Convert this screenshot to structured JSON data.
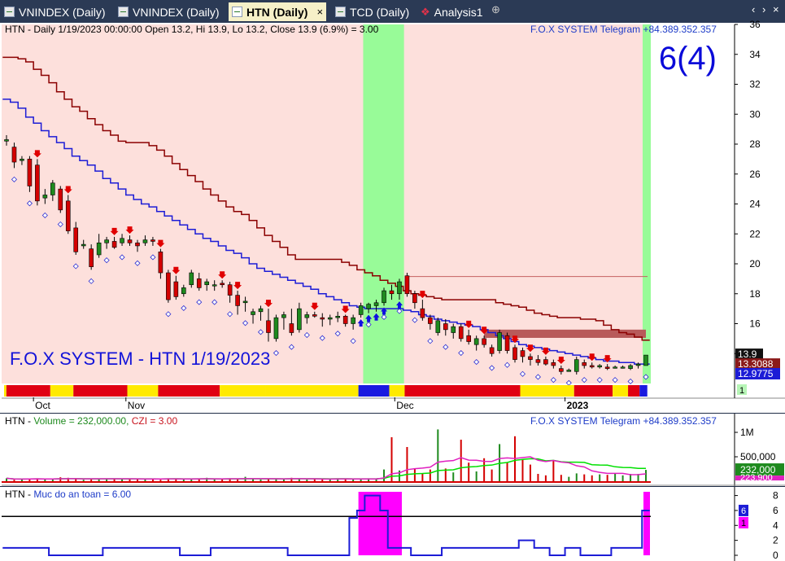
{
  "tabs": [
    {
      "label": "VNINDEX (Daily)",
      "icon": "chart-icon",
      "active": false
    },
    {
      "label": "VNINDEX (Daily)",
      "icon": "chart-icon",
      "active": false
    },
    {
      "label": "HTN (Daily)",
      "icon": "chart-icon",
      "active": true
    },
    {
      "label": "TCD (Daily)",
      "icon": "chart-icon",
      "active": false
    },
    {
      "label": "Analysis1",
      "icon": "analysis-icon",
      "active": false
    }
  ],
  "nav": {
    "add": "⊕",
    "prev": "‹",
    "next": "›",
    "close": "×"
  },
  "price_pane": {
    "header": "HTN - Daily 1/19/2023 00:00:00 Open 13.2, Hi 13.9, Lo 13.2, Close 13.9 (6.9%)  = 3.00",
    "watermark": "F.O.X SYSTEM Telegram +84.389.352.357",
    "count_label": "6(4)",
    "brand_label": "F.O.X SYSTEM - HTN 1/19/2023",
    "y_ticks": [
      "36",
      "34",
      "32",
      "30",
      "28",
      "26",
      "24",
      "22",
      "20",
      "18",
      "16",
      "14"
    ],
    "x_ticks": [
      "Oct",
      "Nov",
      "Dec",
      "2023"
    ],
    "price_close_tag": "13.9",
    "upper_line_tag": "13.3088",
    "lower_line_tag": "12.9775",
    "small_tag": "1",
    "colors": {
      "bg_pink": "#fde0dc",
      "bg_green": "#98fb98",
      "upper": "#8b0000",
      "lower": "#1c1cd6",
      "up": "#1e8a1e",
      "down": "#d40000"
    }
  },
  "volume_pane": {
    "header_sym": "HTN - ",
    "header_vol": "Volume = 232,000.00, ",
    "header_czi": "CZI = 3.00",
    "watermark": "F.O.X SYSTEM Telegram +84.389.352.357",
    "y_ticks": [
      "1M",
      "500,000"
    ],
    "vol_tag": "232,000",
    "vol_tag2": "223,900"
  },
  "safety_pane": {
    "header_sym": "HTN - ",
    "header_ind": "Muc do an toan = 6.00",
    "y_ticks": [
      "8",
      "6",
      "4",
      "2",
      "0"
    ],
    "value_tag": "6",
    "value_tag2": "1"
  },
  "chart_data": {
    "type": "candlestick",
    "symbol": "HTN",
    "ylim": [
      12,
      36
    ],
    "candles": [
      [
        28.2,
        28.6,
        27.9,
        28.3
      ],
      [
        27.8,
        28.1,
        26.4,
        26.8
      ],
      [
        26.9,
        27.2,
        26.6,
        27.0
      ],
      [
        27.0,
        27.2,
        24.8,
        25.2
      ],
      [
        26.6,
        27.0,
        23.9,
        24.2
      ],
      [
        24.4,
        25.0,
        24.0,
        24.6
      ],
      [
        24.6,
        25.6,
        24.2,
        25.4
      ],
      [
        25.0,
        25.2,
        23.4,
        23.6
      ],
      [
        24.2,
        24.6,
        22.0,
        22.2
      ],
      [
        22.4,
        22.8,
        20.6,
        20.8
      ],
      [
        21.2,
        21.6,
        21.0,
        21.3
      ],
      [
        21.0,
        21.3,
        19.6,
        19.8
      ],
      [
        20.6,
        22.0,
        20.4,
        21.4
      ],
      [
        21.4,
        21.8,
        21.0,
        21.6
      ],
      [
        21.5,
        21.8,
        21.0,
        21.1
      ],
      [
        21.4,
        22.0,
        21.2,
        21.7
      ],
      [
        21.6,
        21.9,
        21.2,
        21.4
      ],
      [
        21.4,
        21.6,
        20.8,
        21.2
      ],
      [
        21.4,
        21.9,
        21.2,
        21.6
      ],
      [
        21.6,
        21.8,
        21.2,
        21.5
      ],
      [
        20.8,
        21.0,
        19.0,
        19.4
      ],
      [
        19.4,
        19.6,
        17.4,
        17.6
      ],
      [
        18.8,
        19.2,
        17.6,
        17.8
      ],
      [
        18.0,
        18.6,
        17.8,
        18.4
      ],
      [
        18.6,
        19.6,
        18.4,
        19.4
      ],
      [
        19.0,
        19.4,
        18.2,
        18.4
      ],
      [
        18.6,
        19.0,
        18.2,
        18.8
      ],
      [
        18.6,
        18.9,
        18.2,
        18.6
      ],
      [
        18.7,
        18.9,
        18.4,
        18.6
      ],
      [
        18.6,
        18.8,
        17.4,
        17.9
      ],
      [
        17.9,
        18.2,
        16.6,
        17.2
      ],
      [
        17.4,
        17.8,
        16.8,
        17.5
      ],
      [
        16.6,
        17.0,
        16.0,
        16.8
      ],
      [
        16.8,
        17.2,
        16.2,
        17.0
      ],
      [
        16.2,
        17.0,
        14.8,
        15.4
      ],
      [
        15.0,
        16.6,
        14.8,
        16.4
      ],
      [
        16.4,
        16.8,
        15.6,
        16.6
      ],
      [
        16.0,
        17.0,
        15.2,
        15.4
      ],
      [
        15.6,
        17.4,
        15.4,
        17.0
      ],
      [
        16.4,
        16.8,
        16.0,
        16.6
      ],
      [
        16.6,
        16.8,
        16.4,
        16.5
      ],
      [
        16.4,
        16.7,
        15.8,
        16.3
      ],
      [
        16.3,
        16.6,
        15.9,
        16.4
      ],
      [
        16.4,
        16.8,
        16.1,
        16.5
      ],
      [
        16.5,
        16.6,
        15.8,
        16.0
      ],
      [
        16.0,
        16.6,
        15.6,
        16.4
      ],
      [
        16.6,
        17.4,
        16.4,
        17.2
      ],
      [
        17.0,
        17.4,
        16.7,
        17.3
      ],
      [
        17.2,
        17.6,
        16.8,
        17.4
      ],
      [
        17.4,
        18.4,
        17.2,
        18.2
      ],
      [
        18.2,
        18.6,
        17.6,
        18.0
      ],
      [
        18.0,
        19.0,
        17.6,
        18.8
      ],
      [
        19.2,
        19.4,
        17.8,
        18.0
      ],
      [
        18.0,
        18.2,
        17.0,
        17.4
      ],
      [
        17.0,
        17.6,
        16.2,
        16.4
      ],
      [
        16.4,
        16.6,
        15.6,
        16.0
      ],
      [
        15.4,
        16.4,
        15.2,
        16.2
      ],
      [
        16.0,
        16.3,
        15.2,
        15.6
      ],
      [
        15.4,
        16.0,
        15.0,
        15.8
      ],
      [
        15.8,
        16.0,
        14.8,
        15.0
      ],
      [
        15.2,
        15.6,
        14.6,
        14.8
      ],
      [
        14.6,
        15.2,
        14.2,
        15.0
      ],
      [
        15.0,
        15.2,
        14.4,
        14.6
      ],
      [
        14.4,
        14.6,
        13.8,
        14.0
      ],
      [
        14.2,
        15.6,
        14.0,
        15.4
      ],
      [
        15.2,
        15.4,
        14.0,
        14.2
      ],
      [
        14.4,
        14.6,
        13.4,
        13.6
      ],
      [
        14.2,
        14.4,
        13.4,
        13.8
      ],
      [
        13.8,
        14.0,
        13.2,
        13.6
      ],
      [
        13.6,
        13.9,
        13.2,
        13.4
      ],
      [
        13.6,
        13.8,
        13.2,
        13.3
      ],
      [
        13.4,
        13.6,
        13.0,
        13.2
      ],
      [
        13.0,
        13.2,
        12.6,
        12.8
      ],
      [
        12.8,
        13.0,
        12.8,
        12.9
      ],
      [
        12.8,
        13.8,
        12.6,
        13.6
      ],
      [
        13.4,
        13.6,
        13.0,
        13.2
      ],
      [
        13.2,
        13.4,
        13.0,
        13.1
      ],
      [
        13.1,
        13.3,
        13.0,
        13.2
      ],
      [
        13.1,
        13.3,
        12.9,
        13.0
      ],
      [
        13.1,
        13.2,
        13.0,
        13.1
      ],
      [
        13.1,
        13.2,
        13.0,
        13.1
      ],
      [
        13.0,
        13.3,
        12.9,
        13.2
      ],
      [
        13.2,
        13.4,
        13.0,
        13.3
      ],
      [
        13.2,
        13.9,
        13.2,
        13.9
      ]
    ],
    "upper_line": [
      33.8,
      33.8,
      33.7,
      33.5,
      33.0,
      32.6,
      32.1,
      31.5,
      31.0,
      30.5,
      30.2,
      29.7,
      29.3,
      28.9,
      28.6,
      28.2,
      28.1,
      28.1,
      28.1,
      27.9,
      27.6,
      27.2,
      26.7,
      26.3,
      25.9,
      25.5,
      25.0,
      24.6,
      24.2,
      23.8,
      23.5,
      23.3,
      22.9,
      22.4,
      21.9,
      21.5,
      21.1,
      20.6,
      20.3,
      20.3,
      20.3,
      20.3,
      20.3,
      20.3,
      20.1,
      19.9,
      19.6,
      19.4,
      19.2,
      18.9,
      18.7,
      18.5,
      18.2,
      18.0,
      17.9,
      17.8,
      17.7,
      17.6,
      17.6,
      17.6,
      17.6,
      17.6,
      17.6,
      17.6,
      17.4,
      17.3,
      17.2,
      17.1,
      16.9,
      16.7,
      16.6,
      16.5,
      16.4,
      16.4,
      16.4,
      16.3,
      16.3,
      16.2,
      15.9,
      15.6,
      15.4,
      15.3,
      15.1,
      14.9,
      14.7,
      14.7,
      14.7,
      14.7,
      14.7,
      14.7,
      14.7,
      14.7,
      14.7,
      14.7,
      14.7,
      14.7,
      14.7,
      14.7,
      14.7,
      14.7,
      14.7,
      14.7,
      14.7,
      14.7,
      14.7,
      14.7,
      14.7,
      14.7,
      14.7,
      14.7,
      14.7,
      14.7,
      14.7,
      14.7,
      14.7,
      14.7,
      14.7,
      14.7,
      14.7,
      14.7,
      14.7,
      14.7,
      14.7,
      14.7,
      14.7,
      14.7,
      14.7,
      14.7,
      14.7,
      14.7,
      14.7,
      14.7,
      14.7,
      14.7,
      14.7,
      14.7,
      14.7,
      14.7,
      14.7,
      14.7,
      14.7,
      14.7,
      14.7,
      14.7,
      14.7,
      14.7,
      14.7,
      14.7,
      14.7,
      14.7,
      14.7,
      14.7,
      14.7,
      14.7,
      14.7,
      14.7
    ],
    "lower_line": [
      31.0,
      30.8,
      30.4,
      29.8,
      29.4,
      28.9,
      28.5,
      28.1,
      27.7,
      27.2,
      26.9,
      26.6,
      26.2,
      25.7,
      25.4,
      25.0,
      24.6,
      24.3,
      24.0,
      23.8,
      23.5,
      23.2,
      22.9,
      22.6,
      22.3,
      22.0,
      21.7,
      21.5,
      21.2,
      20.9,
      20.7,
      20.4,
      20.0,
      19.7,
      19.5,
      19.3,
      19.1,
      18.9,
      18.7,
      18.5,
      18.3,
      18.0,
      17.8,
      17.6,
      17.4,
      17.2,
      17.1,
      17.0,
      17.0,
      17.0,
      17.0,
      17.0,
      16.9,
      16.8,
      16.6,
      16.5,
      16.3,
      16.2,
      16.1,
      16.0,
      15.9,
      15.8,
      15.6,
      15.4,
      15.2,
      15.0,
      14.8,
      14.6,
      14.5,
      14.4,
      14.3,
      14.2,
      14.1,
      14.0,
      13.9,
      13.8,
      13.7,
      13.6,
      13.5,
      13.5,
      13.4,
      13.4,
      13.3,
      13.3
    ],
    "volume_k": [
      60,
      30,
      40,
      50,
      60,
      40,
      40,
      80,
      70,
      45,
      30,
      40,
      40,
      60,
      50,
      40,
      50,
      45,
      55,
      40,
      30,
      60,
      55,
      40,
      45,
      55,
      70,
      35,
      40,
      60,
      40,
      90,
      50,
      35,
      40,
      50,
      40,
      70,
      45,
      35,
      40,
      45,
      40,
      60,
      45,
      40,
      45,
      60,
      55,
      240,
      900,
      220,
      700,
      260,
      160,
      240,
      1060,
      260,
      180,
      850,
      380,
      200,
      470,
      240,
      760,
      380,
      920,
      450,
      340,
      150,
      120,
      420,
      130,
      90,
      160,
      140,
      120,
      140,
      130,
      160,
      120,
      150,
      150,
      232
    ],
    "safety": [
      1,
      1,
      1,
      1,
      1,
      1,
      0,
      0,
      0,
      0,
      0,
      0,
      0,
      1,
      1,
      1,
      1,
      1,
      1,
      1,
      1,
      1,
      1,
      0,
      0,
      0,
      0,
      1,
      1,
      1,
      1,
      1,
      1,
      1,
      1,
      1,
      1,
      0,
      0,
      0,
      0,
      0,
      0,
      0,
      0,
      5,
      6,
      8,
      8,
      6,
      1,
      1,
      1,
      0,
      0,
      0,
      0,
      1,
      1,
      1,
      1,
      1,
      1,
      1,
      1,
      1,
      1,
      2,
      2,
      1,
      1,
      0,
      0,
      1,
      1,
      0,
      0,
      0,
      0,
      1,
      1,
      1,
      1,
      6
    ]
  }
}
